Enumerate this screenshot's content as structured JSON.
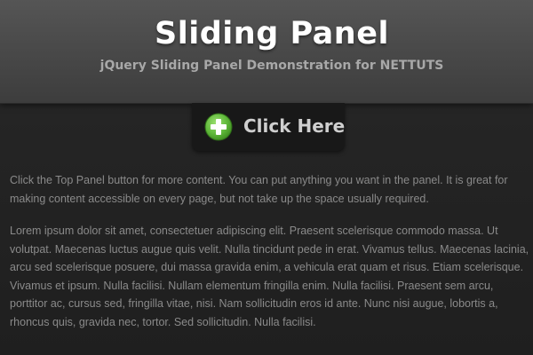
{
  "header": {
    "title": "Sliding Panel",
    "subtitle": "jQuery Sliding Panel Demonstration for NETTUTS"
  },
  "toggle_button": {
    "label": "Click Here",
    "icon": "plus-icon"
  },
  "content": {
    "intro": "Click the Top Panel button for more content. You can put anything you want in the panel. It is great for making content accessible on every page, but not take up the space usually required.",
    "lorem": "Lorem ipsum dolor sit amet, consectetuer adipiscing elit. Praesent scelerisque commodo massa. Ut volutpat. Maecenas luctus augue quis velit. Nulla tincidunt pede in erat. Vivamus tellus. Maecenas lacinia, arcu sed scelerisque posuere, dui massa gravida enim, a vehicula erat quam et risus. Etiam scelerisque. Vivamus et ipsum. Nulla facilisi. Nullam elementum fringilla enim. Nulla facilisi. Praesent sem arcu, porttitor ac, cursus sed, fringilla vitae, nisi. Nam sollicitudin eros id ante. Nunc nisi augue, lobortis a, rhoncus quis, gravida nec, tortor. Sed sollicitudin. Nulla facilisi."
  },
  "colors": {
    "page_background": "#232323",
    "header_background": "#4a4a4a",
    "title_text": "#ffffff",
    "subtitle_text": "#a8a8a8",
    "button_background": "#181818",
    "button_text": "#cfcfcf",
    "plus_icon_green": "#5fb83a",
    "body_text": "#8a8a8a"
  }
}
